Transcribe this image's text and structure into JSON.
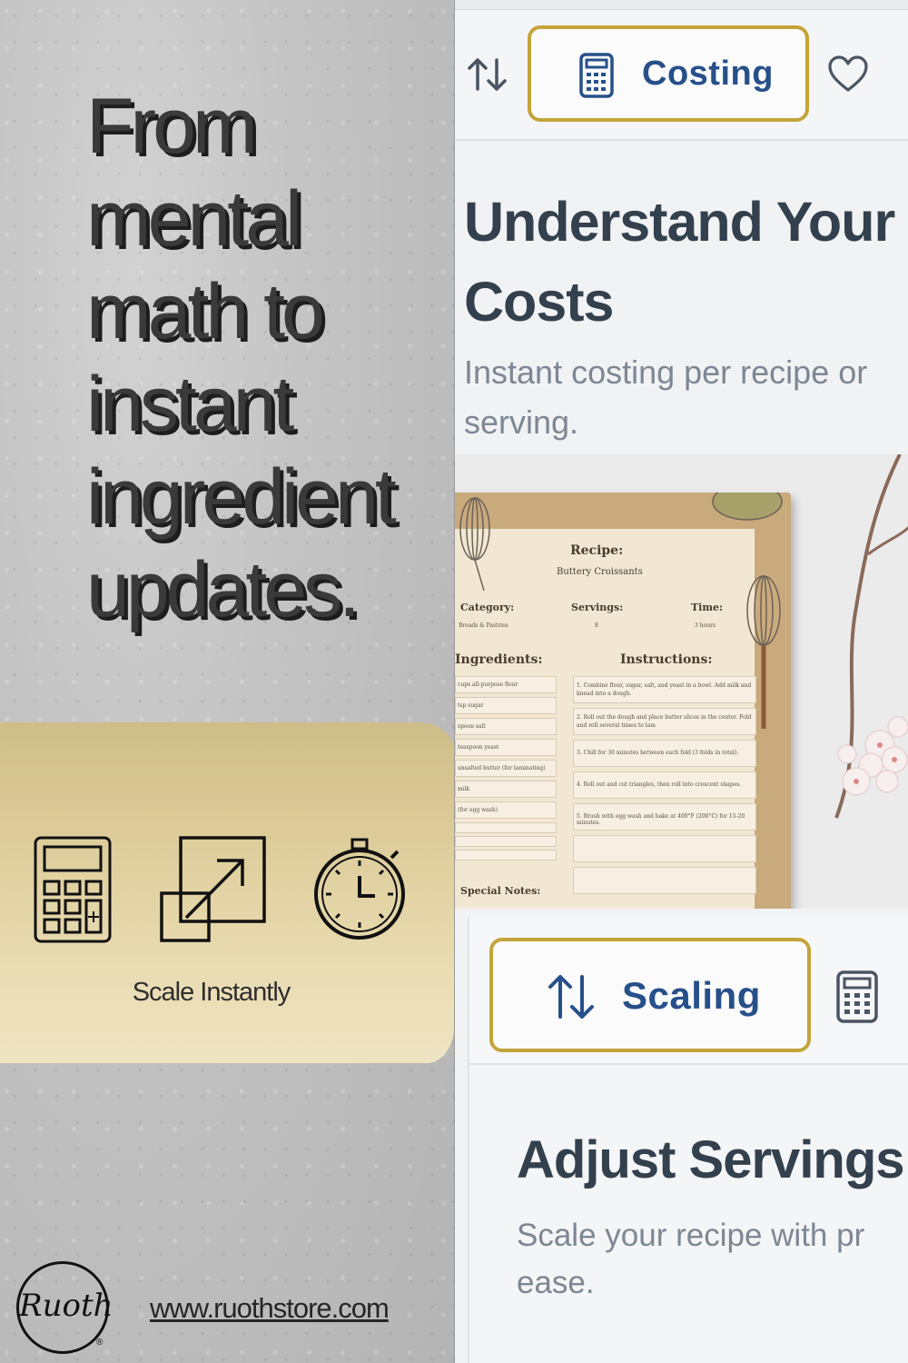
{
  "promo": {
    "headline": "From mental math to instant ingredient updates.",
    "caption": "Scale Instantly",
    "website": "www.ruothstore.com",
    "logo_text": "Ruoth",
    "logo_mark": "®",
    "icons": [
      "calculator-icon",
      "resize-icon",
      "stopwatch-icon"
    ]
  },
  "app_top": {
    "active_tab": "Costing",
    "icons": [
      "sort-icon",
      "calculator-icon",
      "heart-icon"
    ],
    "title": "Understand Your Costs",
    "subtitle": "Instant costing per recipe or serving."
  },
  "recipe_card": {
    "recipe_label": "Recipe:",
    "recipe_name": "Buttery Croissants",
    "category_label": "Category:",
    "category_value": "Breads & Pastries",
    "servings_label": "Servings:",
    "servings_value": "8",
    "time_label": "Time:",
    "time_value": "3 hours",
    "ingredients_label": "Ingredients:",
    "instructions_label": "Instructions:",
    "notes_label": "Special Notes:",
    "ingredients": [
      "cups all-purpose flour",
      "tsp sugar",
      "spoon salt",
      "teaspoon yeast",
      "unsalted butter (for laminating)",
      "milk",
      "(for egg wash)"
    ],
    "instructions": [
      "1. Combine flour, sugar, salt, and yeast in a bowl. Add milk and knead into a dough.",
      "2. Roll out the dough and place butter slices in the center. Fold and roll several times to lam",
      "3. Chill for 30 minutes between each fold (3 folds in total).",
      "4. Roll out and cut triangles, then roll into crescent shapes.",
      "5. Brush with egg wash and bake at 400°F (200°C) for 15-20 minutes."
    ]
  },
  "app_bottom": {
    "active_tab": "Scaling",
    "icons": [
      "sort-icon",
      "calculator-icon"
    ],
    "title": "Adjust Servings",
    "subtitle": "Scale your recipe with pr ease."
  },
  "colors": {
    "accent_border": "#c3a43a",
    "tab_text": "#27508a",
    "title_text": "#33404e",
    "subtitle_text": "#7d8794"
  }
}
